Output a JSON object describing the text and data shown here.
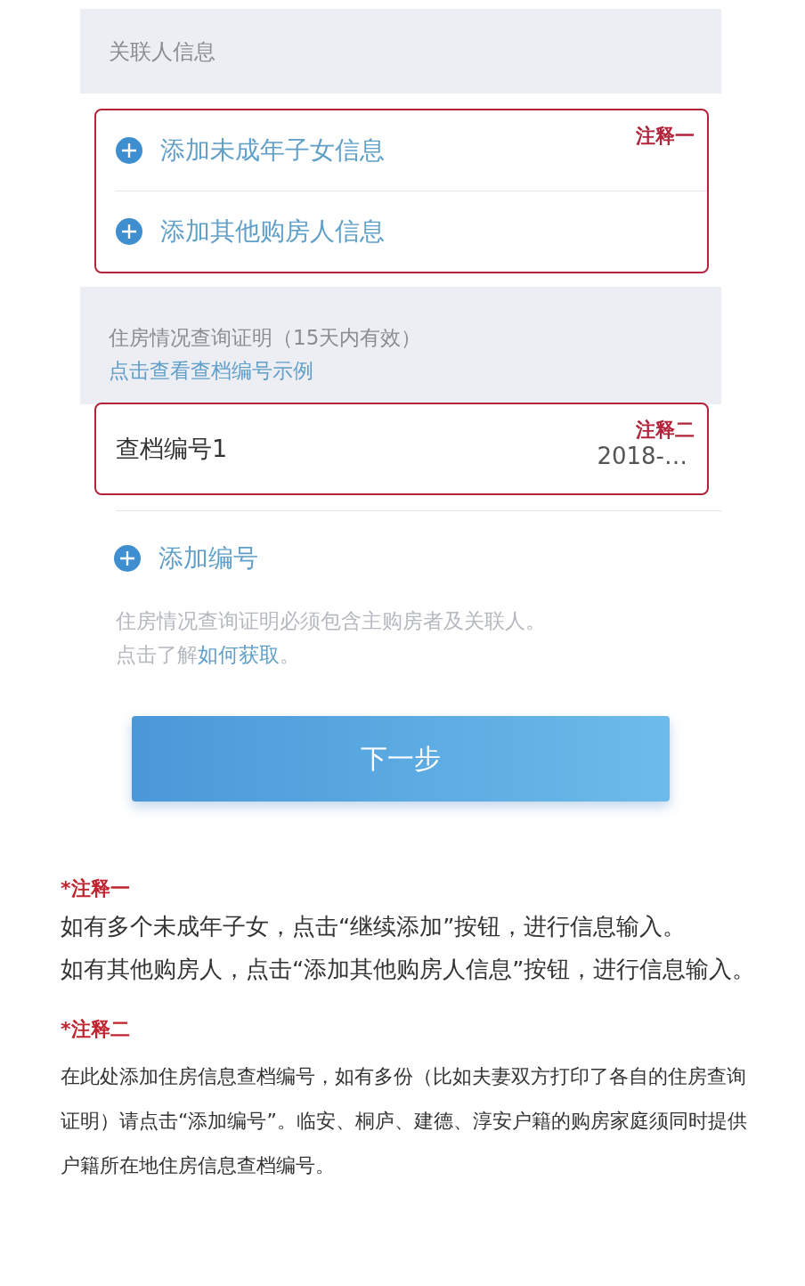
{
  "related_section": {
    "title": "关联人信息"
  },
  "related_actions": [
    {
      "label": "添加未成年子女信息"
    },
    {
      "label": "添加其他购房人信息"
    }
  ],
  "annotation_1": "注释一",
  "certificate_section": {
    "title": "住房情况查询证明（15天内有效）",
    "link": "点击查看查档编号示例"
  },
  "archive_number": {
    "label": "查档编号1",
    "value": "2018-…",
    "annotation": "注释二"
  },
  "add_number": "添加编号",
  "hint": {
    "line1": "住房情况查询证明必须包含主购房者及关联人。",
    "prefix": "点击了解",
    "link": "如何获取",
    "suffix": "。"
  },
  "next_button": "下一步",
  "notes": [
    {
      "mark": "*",
      "title": "注释一",
      "paragraphs": [
        "如有多个未成年子女，点击“继续添加”按钮，进行信息输入。",
        "如有其他购房人，点击“添加其他购房人信息”按钮，进行信息输入。"
      ]
    },
    {
      "mark": "*",
      "title": "注释二",
      "paragraphs": [
        "在此处添加住房信息查档编号，如有多份（比如夫妻双方打印了各自的住房查询证明）请点击“添加编号”。临安、桐庐、建德、淳安户籍的购房家庭须同时提供户籍所在地住房信息查档编号。"
      ]
    }
  ]
}
